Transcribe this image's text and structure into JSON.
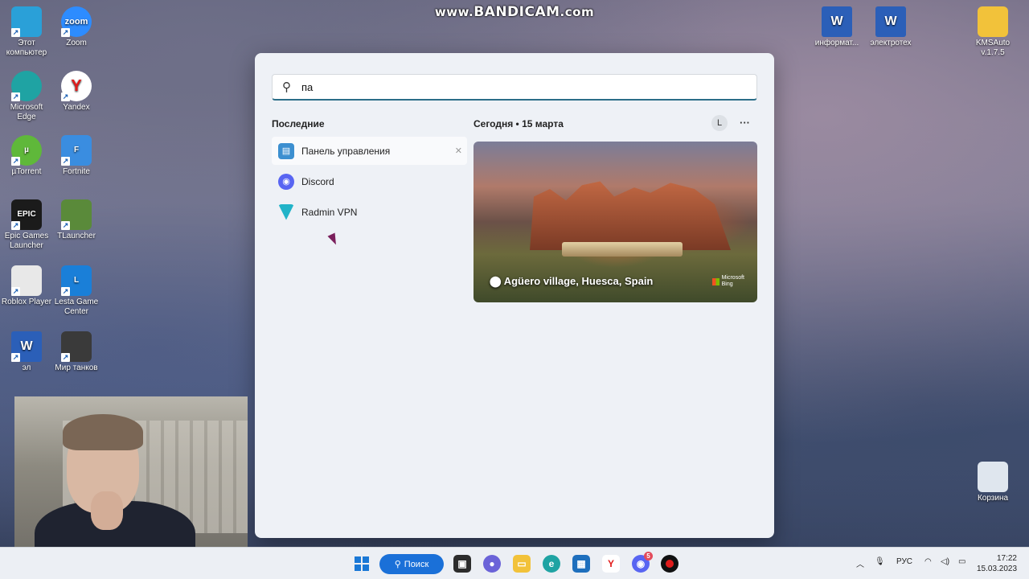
{
  "watermark": {
    "prefix": "www.",
    "brand": "BANDICAM",
    "suffix": ".com"
  },
  "desktop": {
    "icons_left": [
      {
        "label": "Этот компьютер",
        "icon": "monitor-icon",
        "color": "#2aa0d8"
      },
      {
        "label": "Zoom",
        "icon": "zoom-icon",
        "color": "#2d8cff",
        "glyph": "zoom"
      },
      {
        "label": "Microsoft Edge",
        "icon": "edge-icon",
        "color": "#1fa3a3"
      },
      {
        "label": "Yandex",
        "icon": "yandex-icon",
        "color": "#ffffff",
        "glyph": "Y"
      },
      {
        "label": "µTorrent",
        "icon": "utorrent-icon",
        "color": "#5fb83a",
        "glyph": "µ"
      },
      {
        "label": "Fortnite",
        "icon": "fortnite-icon",
        "color": "#3a8de0",
        "glyph": "F"
      },
      {
        "label": "Epic Games Launcher",
        "icon": "epic-games-icon",
        "color": "#1b1b1b",
        "glyph": "EPIC"
      },
      {
        "label": "TLauncher",
        "icon": "tlauncher-icon",
        "color": "#5a8a3a"
      },
      {
        "label": "Roblox Player",
        "icon": "roblox-icon",
        "color": "#e8e8e8"
      },
      {
        "label": "Lesta Game Center",
        "icon": "lesta-icon",
        "color": "#1a7fd8",
        "glyph": "L"
      },
      {
        "label": "эл",
        "icon": "word-icon",
        "color": "#2b5fb8",
        "glyph": "W"
      },
      {
        "label": "Мир танков",
        "icon": "tanks-icon",
        "color": "#3a3a3a"
      }
    ],
    "icons_right": [
      {
        "label": "информат...",
        "icon": "word-icon",
        "color": "#2b5fb8",
        "glyph": "W"
      },
      {
        "label": "электротех",
        "icon": "word-icon",
        "color": "#2b5fb8",
        "glyph": "W"
      },
      {
        "label": "KMSAuto v.1.7.5",
        "icon": "folder-icon",
        "color": "#f2c23a"
      },
      {
        "label": "Корзина",
        "icon": "recycle-bin-icon",
        "color": "#dfe6ee"
      }
    ]
  },
  "start_menu": {
    "search_value": "па",
    "recent_title": "Последние",
    "recent": [
      {
        "label": "Панель управления",
        "icon": "control-panel-icon",
        "color": "#3c8fd0"
      },
      {
        "label": "Discord",
        "icon": "discord-icon",
        "color": "#5865f2"
      },
      {
        "label": "Radmin VPN",
        "icon": "radmin-vpn-icon",
        "color": "#21b3c8"
      }
    ],
    "today_label": "Сегодня",
    "date": "15 марта",
    "avatar_letter": "L",
    "more_label": "···",
    "photo_caption": "Agüero village, Huesca, Spain",
    "bing_label_1": "Microsoft",
    "bing_label_2": "Bing"
  },
  "taskbar": {
    "search_label": "Поиск",
    "discord_badge": "5",
    "language": "РУС",
    "time": "17:22",
    "date": "15.03.2023"
  }
}
